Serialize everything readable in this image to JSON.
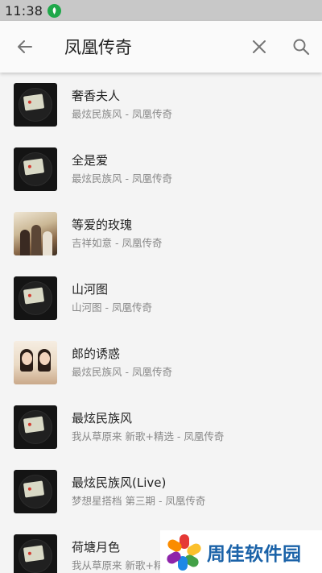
{
  "status_bar": {
    "time": "11:38"
  },
  "search": {
    "query": "凤凰传奇"
  },
  "results": [
    {
      "title": "奢香夫人",
      "subtitle": "最炫民族风 - 凤凰传奇",
      "art": "disc"
    },
    {
      "title": "全是爱",
      "subtitle": "最炫民族风 - 凤凰传奇",
      "art": "disc"
    },
    {
      "title": "等爱的玫瑰",
      "subtitle": "吉祥如意 - 凤凰传奇",
      "art": "photo1"
    },
    {
      "title": "山河图",
      "subtitle": "山河图 - 凤凰传奇",
      "art": "disc"
    },
    {
      "title": "郎的诱惑",
      "subtitle": "最炫民族风 - 凤凰传奇",
      "art": "photo2"
    },
    {
      "title": "最炫民族风",
      "subtitle": "我从草原来 新歌+精选 - 凤凰传奇",
      "art": "disc"
    },
    {
      "title": "最炫民族风(Live)",
      "subtitle": "梦想星搭档 第三期 - 凤凰传奇",
      "art": "disc"
    },
    {
      "title": "荷塘月色",
      "subtitle": "我从草原来 新歌+精选 - 凤凰传奇",
      "art": "disc"
    }
  ],
  "watermark": {
    "text": "周佳软件园"
  },
  "colors": {
    "status_bar": "#c8c8c8",
    "notification_icon": "#1fa84a",
    "watermark_text": "#1a62a8"
  }
}
